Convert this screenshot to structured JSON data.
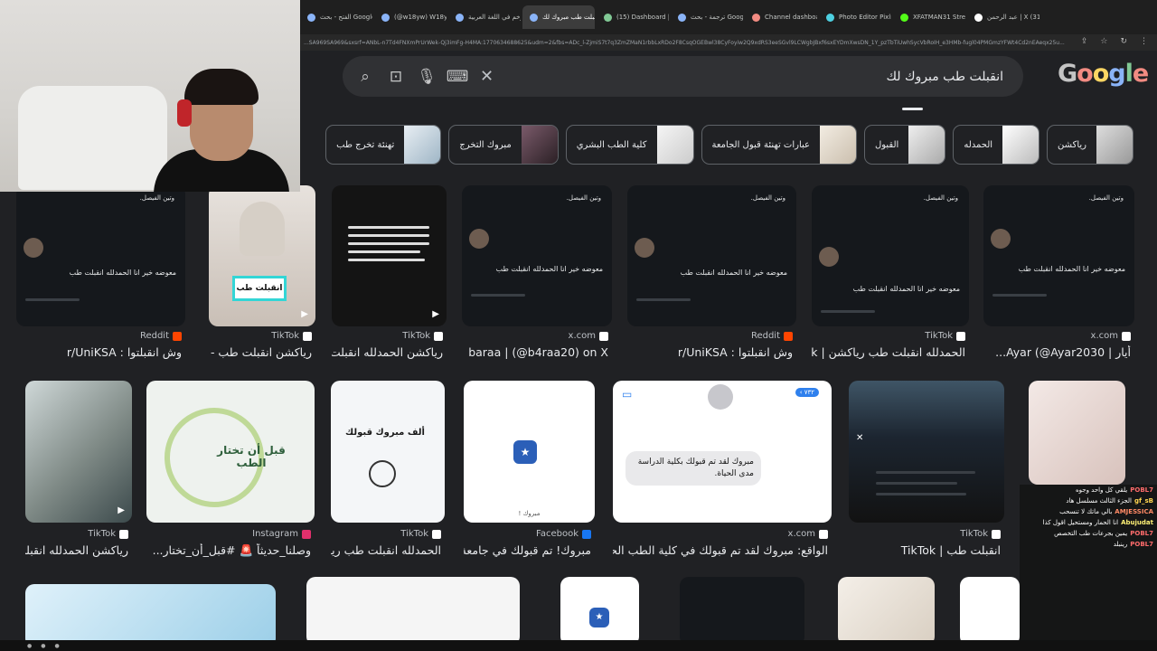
{
  "browser": {
    "tabs": [
      {
        "label": "الفتح - بحث Google"
      },
      {
        "label": "(@w18yw) W18yw ويلي"
      },
      {
        "label": "الزخم في اللغة العربية"
      },
      {
        "label": "انقبلت طب مبروك لك",
        "active": true
      },
      {
        "label": "(15) Dashboard | Strea"
      },
      {
        "label": "ترجمة - بحث Google"
      },
      {
        "label": "Channel dashboard -"
      },
      {
        "label": "Photo Editor Pixlr Free"
      },
      {
        "label": "XFATMAN31 Stream"
      },
      {
        "label": "عبد الرحمن | X (31"
      }
    ],
    "url": "...SA969SA969&sxsrf=ANbL-n7Td4FNXmPrUrWek-Qj3imFg-H4MA:1770634688625&udm=2&fbs=ADc_l-ZjmiS7t7q3ZmZMaN1rbbLxRDo2F8CsqOGEBwl38CyFoyiw2Q9xdRS3eeSGvl9LCWgbJBxf6sxEYDmXwsDN_1Y_pzTbTiUwhSycVbRoIH_e3HMb-fugl04PMGmzYFWt4Cd2nEAeqx25u..."
  },
  "search": {
    "query": "انقبلت طب مبروك لك",
    "logo": "Google"
  },
  "chips": [
    {
      "label": "رياكشن"
    },
    {
      "label": "الحمدله"
    },
    {
      "label": "القبول"
    },
    {
      "label": "عبارات تهنئة قبول الجامعة"
    },
    {
      "label": "كلية الطب البشري"
    },
    {
      "label": "مبروك التخرج"
    },
    {
      "label": "تهنئة تخرج طب"
    }
  ],
  "row1": [
    {
      "source": "Reddit",
      "title": "وش انقبلتوا : r/UniKSA",
      "tweet_text": "معوضه خير انا الحمدلله انقبلت طب"
    },
    {
      "source": "TikTok",
      "title": "رياكشن انقبلت طب - ت...",
      "caption": "انقبلت طب"
    },
    {
      "source": "TikTok",
      "title": "رياكشن الحمدلله انقبلت..."
    },
    {
      "source": "x.com",
      "title": "baraa | (@b4raa20) on X",
      "tweet_text": "معوضه خير انا الحمدلله انقبلت طب"
    },
    {
      "source": "Reddit",
      "title": "وش انقبلتوا : r/UniKSA",
      "tweet_text": "معوضه خير انا الحمدلله انقبلت طب"
    },
    {
      "source": "TikTok",
      "title": "الحمدلله انقبلت طب رياكشن | ok...",
      "tweet_text": "معوضه خير انا الحمدلله انقبلت طب"
    },
    {
      "source": "x.com",
      "title": "أيار | Ayar (@Ayar2030...",
      "tweet_text": "معوضه خير انا الحمدلله انقبلت طب"
    }
  ],
  "row2": [
    {
      "source": "TikTok",
      "title": "رياكشن الحمدلله انقبلت..."
    },
    {
      "source": "Instagram",
      "title": "وصلنا_حديثاً 🚨 #قبل_أن_تختار...",
      "caption": "قبل أن تختار الطب"
    },
    {
      "source": "TikTok",
      "title": "الحمدلله انقبلت طب ريا...",
      "caption": "ألف مبروك قبولك"
    },
    {
      "source": "Facebook",
      "title": "مبروك! تم قبولك في جامعة ...",
      "caption": "مبروك !"
    },
    {
      "source": "x.com",
      "title": "الواقع: مبروك لقد تم قبولك في كلية الطب الحقيقة:",
      "caption": "مبروك لقد تم قبولك بكلية الدراسة مدى الحياة."
    },
    {
      "source": "TikTok",
      "title": "انقبلت طب | TikTok"
    }
  ],
  "chat": [
    {
      "user": "POBL7",
      "msg": "يلقي كل واحد وجوه"
    },
    {
      "user": "gf_sB",
      "msg": "الجزء الثالث مسلسل هاد"
    },
    {
      "user": "AMJESSICA",
      "msg": "بالي ماتك لا تنسحب"
    },
    {
      "user": "Abujudat",
      "msg": "انا الحمار ومستحيل اقول كذا"
    },
    {
      "user": "POBL7",
      "msg": "يمين بجرعات طب التخصص"
    },
    {
      "user": "POBL7",
      "msg": "رينبلد"
    }
  ],
  "colors": {
    "background": "#202124",
    "search_bg": "#303134",
    "text": "#e8eaed",
    "tiktok": "#ffffff",
    "reddit": "#ff4500",
    "instagram": "#e1306c",
    "facebook": "#1877f2"
  }
}
